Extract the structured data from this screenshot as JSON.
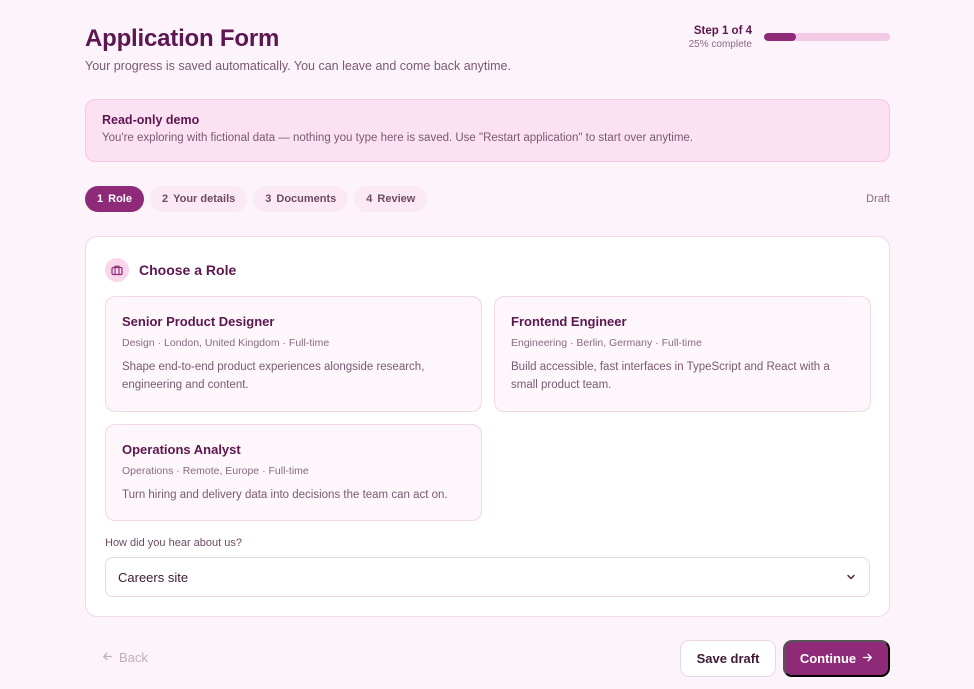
{
  "header": {
    "title": "Application Form",
    "subtitle": "Your progress is saved automatically. You can leave and come back anytime.",
    "step_label": "Step 1 of 4",
    "percent_label": "25% complete",
    "progress": 0.25
  },
  "notice": {
    "title": "Read-only demo",
    "text": "You're exploring with fictional data — nothing you type here is saved. Use \"Restart application\" to start over anytime."
  },
  "steps": [
    {
      "num": "1",
      "label": "Role"
    },
    {
      "num": "2",
      "label": "Your details"
    },
    {
      "num": "3",
      "label": "Documents"
    },
    {
      "num": "4",
      "label": "Review"
    }
  ],
  "status": "Draft",
  "card": {
    "title": "Choose a Role",
    "icon": "briefcase-icon"
  },
  "roles": [
    {
      "name": "Senior Product Designer",
      "meta": "Design · London, United Kingdom · Full-time",
      "desc": "Shape end-to-end product experiences alongside research, engineering and content."
    },
    {
      "name": "Frontend Engineer",
      "meta": "Engineering · Berlin, Germany · Full-time",
      "desc": "Build accessible, fast interfaces in TypeScript and React with a small product team."
    },
    {
      "name": "Operations Analyst",
      "meta": "Operations · Remote, Europe · Full-time",
      "desc": "Turn hiring and delivery data into decisions the team can act on."
    }
  ],
  "source": {
    "label": "How did you hear about us?",
    "value": "Careers site"
  },
  "footer": {
    "back": "Back",
    "save": "Save draft",
    "continue": "Continue"
  },
  "colors": {
    "accent": "#8e2a78",
    "background": "#fdf3fa",
    "notice_bg": "#fbe1f1"
  }
}
